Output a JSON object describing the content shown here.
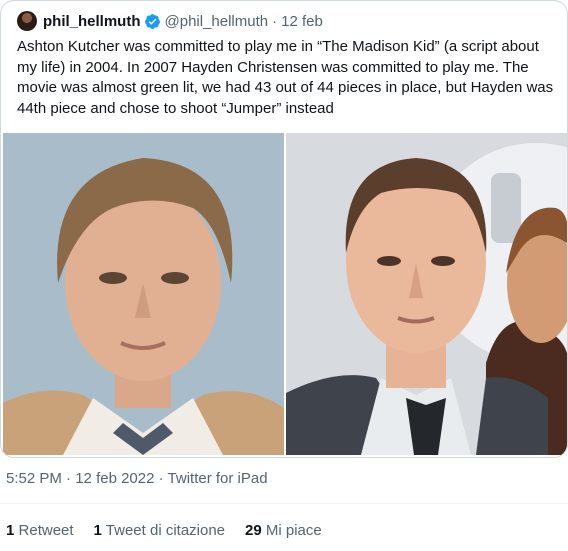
{
  "tweet": {
    "display_name": "phil_hellmuth",
    "handle": "@phil_hellmuth",
    "separator": "·",
    "date": "12 feb",
    "text": "Ashton Kutcher was committed to play me in “The Madison Kid” (a script about my life) in 2004. In 2007 Hayden Christensen was committed to play me. The movie was almost green lit, we had 43 out of 44 pieces in place, but Hayden was 44th piece and chose to shoot “Jumper” instead",
    "verified_icon": "verified-badge-icon",
    "verified_color": "#1d9bf0"
  },
  "media": {
    "left_photo": "photo-portrait-left",
    "right_photo": "photo-portrait-right"
  },
  "meta": {
    "time": "5:52 PM",
    "separator1": "·",
    "full_date": "12 feb 2022",
    "separator2": "·",
    "source": "Twitter for iPad"
  },
  "stats": [
    {
      "count": "1",
      "label": "Retweet"
    },
    {
      "count": "1",
      "label": "Tweet di citazione"
    },
    {
      "count": "29",
      "label": "Mi piace"
    }
  ]
}
